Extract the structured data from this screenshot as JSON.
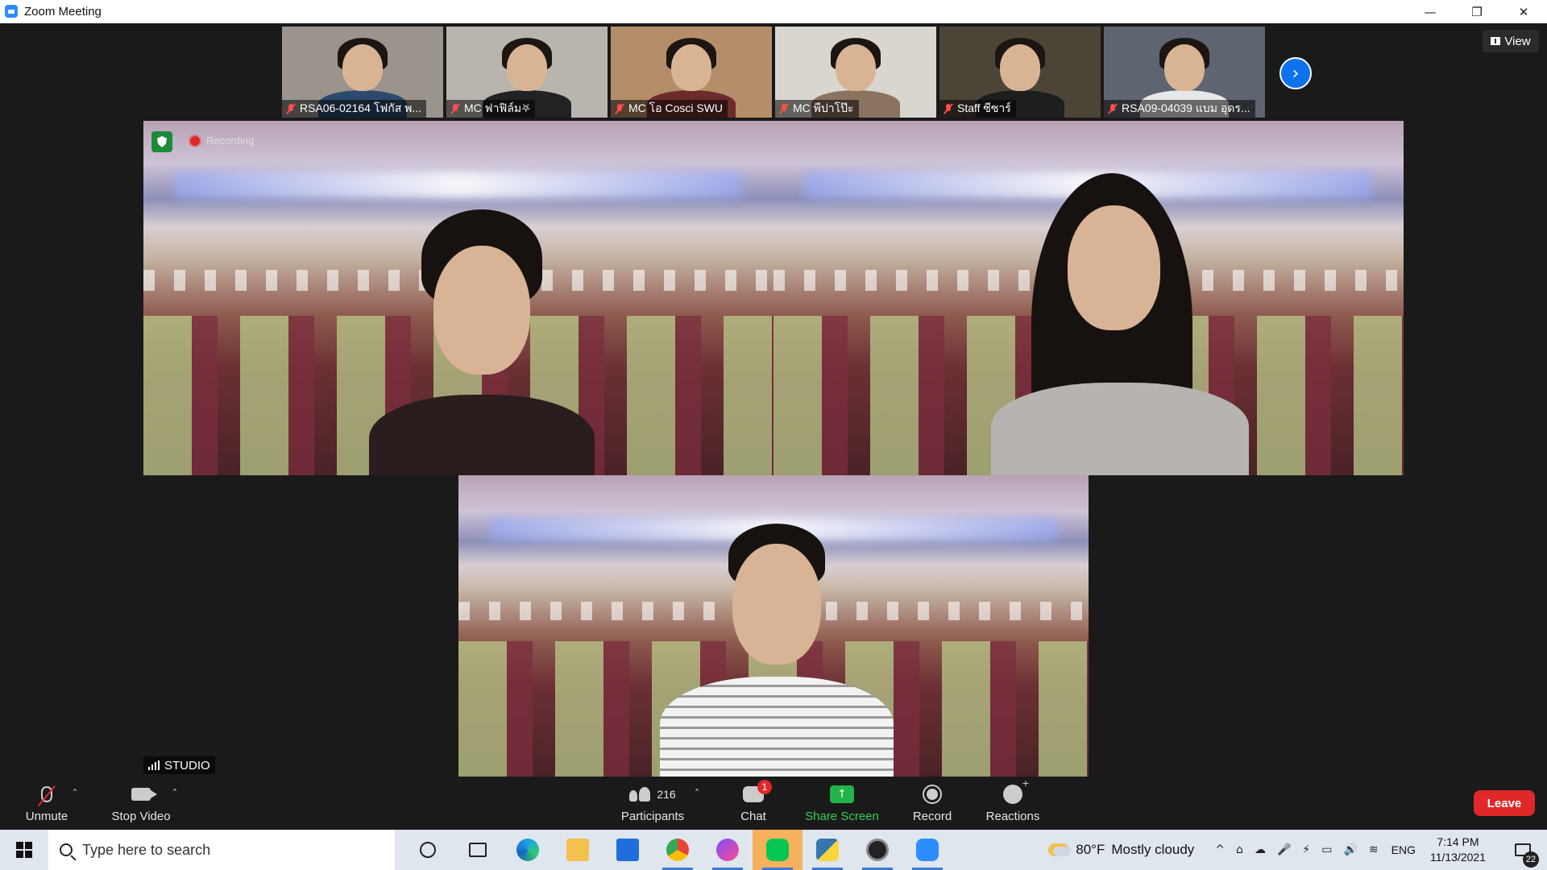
{
  "window": {
    "title": "Zoom Meeting",
    "controls": {
      "minimize": "—",
      "restore": "❐",
      "close": "✕"
    }
  },
  "thumbnails": [
    {
      "name": "RSA06-02164 โฟกัส พ...",
      "muted": true,
      "bg": "#9a948c",
      "shirt": "#2d4a6e"
    },
    {
      "name": "MC ฟาฟิล์ม⛧",
      "muted": true,
      "bg": "#b9b5ae",
      "shirt": "#222222"
    },
    {
      "name": "MC โอ Cosci SWU",
      "muted": true,
      "bg": "#b48d6a",
      "shirt": "#6b2b2b"
    },
    {
      "name": "MC พีปาโป๊ะ",
      "muted": true,
      "bg": "#d9d6cf",
      "shirt": "#8a7460"
    },
    {
      "name": "Staff ซีซาร์",
      "muted": true,
      "bg": "#4d4438",
      "shirt": "#1e1e1e"
    },
    {
      "name": "RSA09-04039 แบม อุดร...",
      "muted": true,
      "bg": "#5e6470",
      "shirt": "#e8e8e8"
    }
  ],
  "next_page_icon": "chevron-right-icon",
  "view_button": {
    "label": "View"
  },
  "recording_status": {
    "label": "Recording"
  },
  "gallery": {
    "active_speaker_label": "STUDIO"
  },
  "toolbar": {
    "unmute": "Unmute",
    "stop_video": "Stop Video",
    "participants": "Participants",
    "participant_count": "216",
    "chat": "Chat",
    "chat_badge": "1",
    "share_screen": "Share Screen",
    "record": "Record",
    "reactions": "Reactions",
    "leave": "Leave",
    "caret": "˄"
  },
  "taskbar": {
    "search_placeholder": "Type here to search",
    "weather_temp": "80°F",
    "weather_text": "Mostly cloudy",
    "lang": "ENG",
    "time": "7:14 PM",
    "date": "11/13/2021",
    "notifications": "22",
    "tray_glyphs": [
      "^",
      "⌂",
      "☁",
      "🎤",
      "⚡",
      "▭",
      "🔊",
      "≋"
    ],
    "apps": [
      "task-view-icon",
      "edge-icon",
      "file-explorer-icon",
      "mail-icon",
      "chrome-icon",
      "messenger-icon",
      "line-icon",
      "python-icon",
      "obs-icon",
      "zoom-icon"
    ]
  },
  "colors": {
    "accent": "#2d8cff",
    "leave": "#e02828",
    "share": "#22b34a",
    "muted": "#ff4d4d"
  }
}
